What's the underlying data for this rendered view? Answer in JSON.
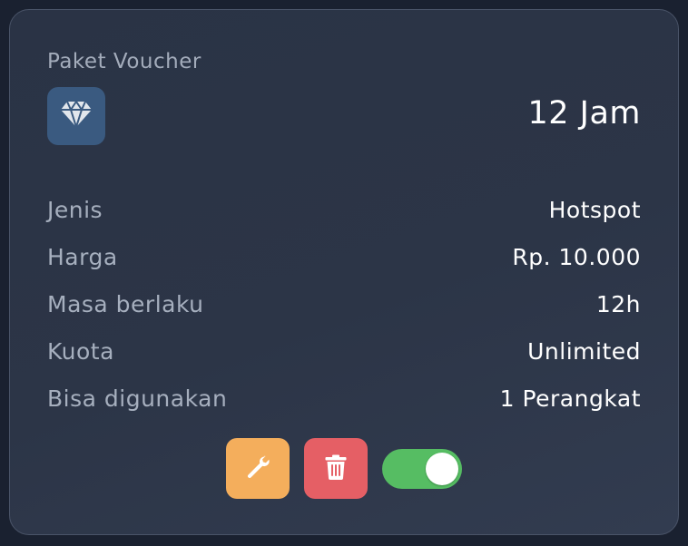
{
  "card": {
    "section_label": "Paket Voucher",
    "title": "12 Jam",
    "icon": "diamond-icon"
  },
  "details": [
    {
      "label": "Jenis",
      "value": "Hotspot"
    },
    {
      "label": "Harga",
      "value": "Rp. 10.000"
    },
    {
      "label": "Masa berlaku",
      "value": "12h"
    },
    {
      "label": "Kuota",
      "value": "Unlimited"
    },
    {
      "label": "Bisa digunakan",
      "value": "1 Perangkat"
    }
  ],
  "actions": {
    "edit_icon": "wrench-icon",
    "delete_icon": "trash-icon",
    "toggle_on": true
  },
  "colors": {
    "card_bg": "#2c3547",
    "icon_box": "#3a5a80",
    "edit": "#f4ae5c",
    "delete": "#e55f65",
    "toggle_on": "#56bd63"
  }
}
